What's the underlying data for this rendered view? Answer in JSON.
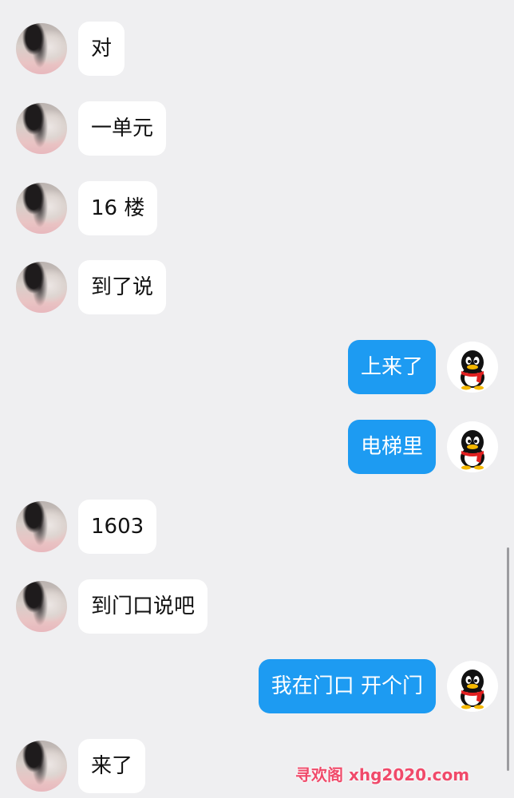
{
  "messages": [
    {
      "side": "in",
      "text": "对"
    },
    {
      "side": "in",
      "text": "一单元"
    },
    {
      "side": "in",
      "text": "16 楼"
    },
    {
      "side": "in",
      "text": "到了说"
    },
    {
      "side": "out",
      "text": "上来了"
    },
    {
      "side": "out",
      "text": "电梯里"
    },
    {
      "side": "in",
      "text": "1603"
    },
    {
      "side": "in",
      "text": "到门口说吧"
    },
    {
      "side": "out",
      "text": "我在门口 开个门"
    },
    {
      "side": "in",
      "text": "来了"
    }
  ],
  "watermark": "寻欢阁 xhg2020.com",
  "colors": {
    "background": "#efeff1",
    "incoming_bubble": "#ffffff",
    "outgoing_bubble": "#1d9bf2",
    "watermark": "#f04a6a"
  },
  "icons": {
    "incoming_avatar": "contact-photo-avatar",
    "outgoing_avatar": "qq-penguin-avatar"
  }
}
